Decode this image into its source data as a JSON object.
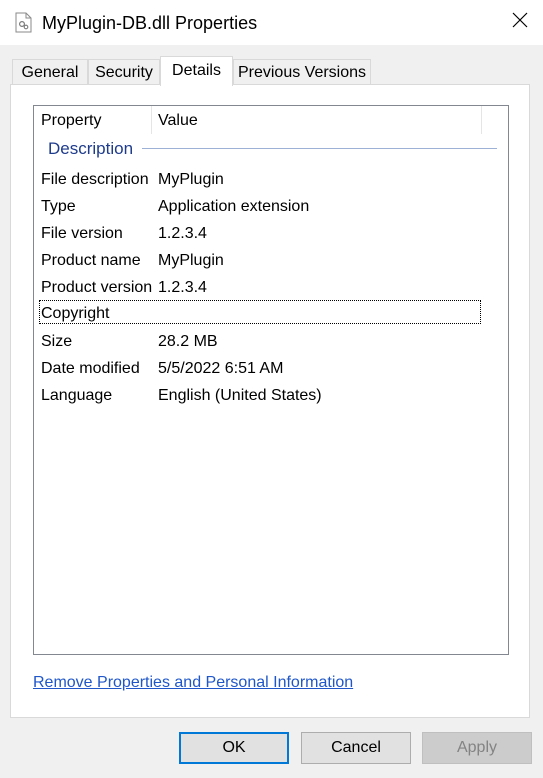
{
  "window": {
    "title": "MyPlugin-DB.dll Properties",
    "icon": "dll-file-icon",
    "close_icon": "close-icon"
  },
  "tabs": [
    {
      "label": "General",
      "active": false
    },
    {
      "label": "Security",
      "active": false
    },
    {
      "label": "Details",
      "active": true
    },
    {
      "label": "Previous Versions",
      "active": false
    }
  ],
  "details": {
    "columns": {
      "property": "Property",
      "value": "Value"
    },
    "group": "Description",
    "rows": [
      {
        "property": "File description",
        "value": "MyPlugin"
      },
      {
        "property": "Type",
        "value": "Application extension"
      },
      {
        "property": "File version",
        "value": "1.2.3.4"
      },
      {
        "property": "Product name",
        "value": "MyPlugin"
      },
      {
        "property": "Product version",
        "value": "1.2.3.4"
      },
      {
        "property": "Copyright",
        "value": ""
      },
      {
        "property": "Size",
        "value": "28.2 MB"
      },
      {
        "property": "Date modified",
        "value": "5/5/2022 6:51 AM"
      },
      {
        "property": "Language",
        "value": "English (United States)"
      }
    ]
  },
  "link": "Remove Properties and Personal Information",
  "buttons": {
    "ok": "OK",
    "cancel": "Cancel",
    "apply": "Apply"
  },
  "colors": {
    "link": "#1f57c8",
    "group_label": "#1e3b8c",
    "primary_border": "#0078d7"
  }
}
